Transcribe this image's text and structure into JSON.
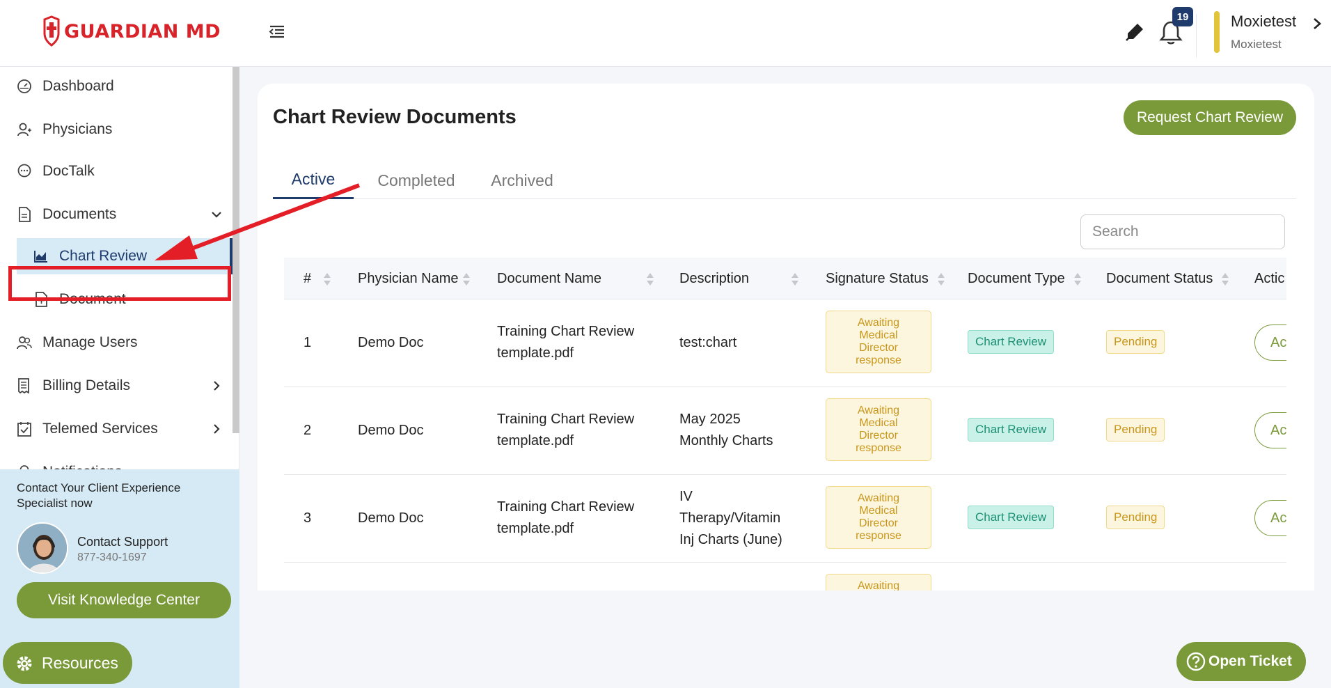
{
  "app": {
    "brand": "GUARDIAN MD",
    "notification_count": "19",
    "user": {
      "name": "Moxietest",
      "org": "Moxietest"
    }
  },
  "sidebar": {
    "items": [
      {
        "label": "Dashboard",
        "icon": "speedometer-icon"
      },
      {
        "label": "Physicians",
        "icon": "user-add-icon"
      },
      {
        "label": "DocTalk",
        "icon": "chat-bubble-icon"
      },
      {
        "label": "Documents",
        "icon": "document-icon",
        "expanded": true
      },
      {
        "label": "Manage Users",
        "icon": "users-icon"
      },
      {
        "label": "Billing Details",
        "icon": "receipt-icon"
      },
      {
        "label": "Telemed Services",
        "icon": "calendar-check-icon"
      },
      {
        "label": "Notifications",
        "icon": "bell-icon"
      }
    ],
    "sub_items": [
      {
        "label": "Chart Review",
        "icon": "chart-icon",
        "active": true
      },
      {
        "label": "Document",
        "icon": "file-plus-icon"
      }
    ],
    "support": {
      "title": "Contact Your Client Experience Specialist now",
      "name": "Contact Support",
      "phone": "877-340-1697",
      "button": "Visit Knowledge Center"
    },
    "resources_label": "Resources"
  },
  "main": {
    "title": "Chart Review Documents",
    "request_button": "Request Chart Review",
    "tabs": [
      {
        "label": "Active",
        "active": true
      },
      {
        "label": "Completed"
      },
      {
        "label": "Archived"
      }
    ],
    "search_placeholder": "Search",
    "table": {
      "columns": [
        "#",
        "Physician Name",
        "Document Name",
        "Description",
        "Signature Status",
        "Document Type",
        "Document Status",
        "Actic"
      ],
      "rows": [
        {
          "num": "1",
          "physician": "Demo Doc",
          "doc_name": [
            "Training Chart Review",
            "template.pdf"
          ],
          "description": [
            "test:chart"
          ],
          "signature": [
            "Awaiting",
            "Medical",
            "Director",
            "response"
          ],
          "doc_type": "Chart Review",
          "doc_status": "Pending",
          "action": "Ac"
        },
        {
          "num": "2",
          "physician": "Demo Doc",
          "doc_name": [
            "Training Chart Review",
            "template.pdf"
          ],
          "description": [
            "May 2025",
            "Monthly Charts"
          ],
          "signature": [
            "Awaiting",
            "Medical",
            "Director",
            "response"
          ],
          "doc_type": "Chart Review",
          "doc_status": "Pending",
          "action": "Ac"
        },
        {
          "num": "3",
          "physician": "Demo Doc",
          "doc_name": [
            "Training Chart Review",
            "template.pdf"
          ],
          "description": [
            "IV",
            "Therapy/Vitamin",
            "Inj Charts (June)"
          ],
          "signature": [
            "Awaiting",
            "Medical",
            "Director",
            "response"
          ],
          "doc_type": "Chart Review",
          "doc_status": "Pending",
          "action": "Ac"
        },
        {
          "num": "",
          "physician": "",
          "doc_name": [],
          "description": [],
          "signature": [
            "Awaiting"
          ],
          "doc_type": "",
          "doc_status": "",
          "action": ""
        }
      ]
    }
  },
  "open_ticket_label": "Open Ticket",
  "colors": {
    "brand_red": "#d8232a",
    "navy": "#1f3b6b",
    "olive": "#7a9a3a",
    "annotation_red": "#e41e26"
  }
}
